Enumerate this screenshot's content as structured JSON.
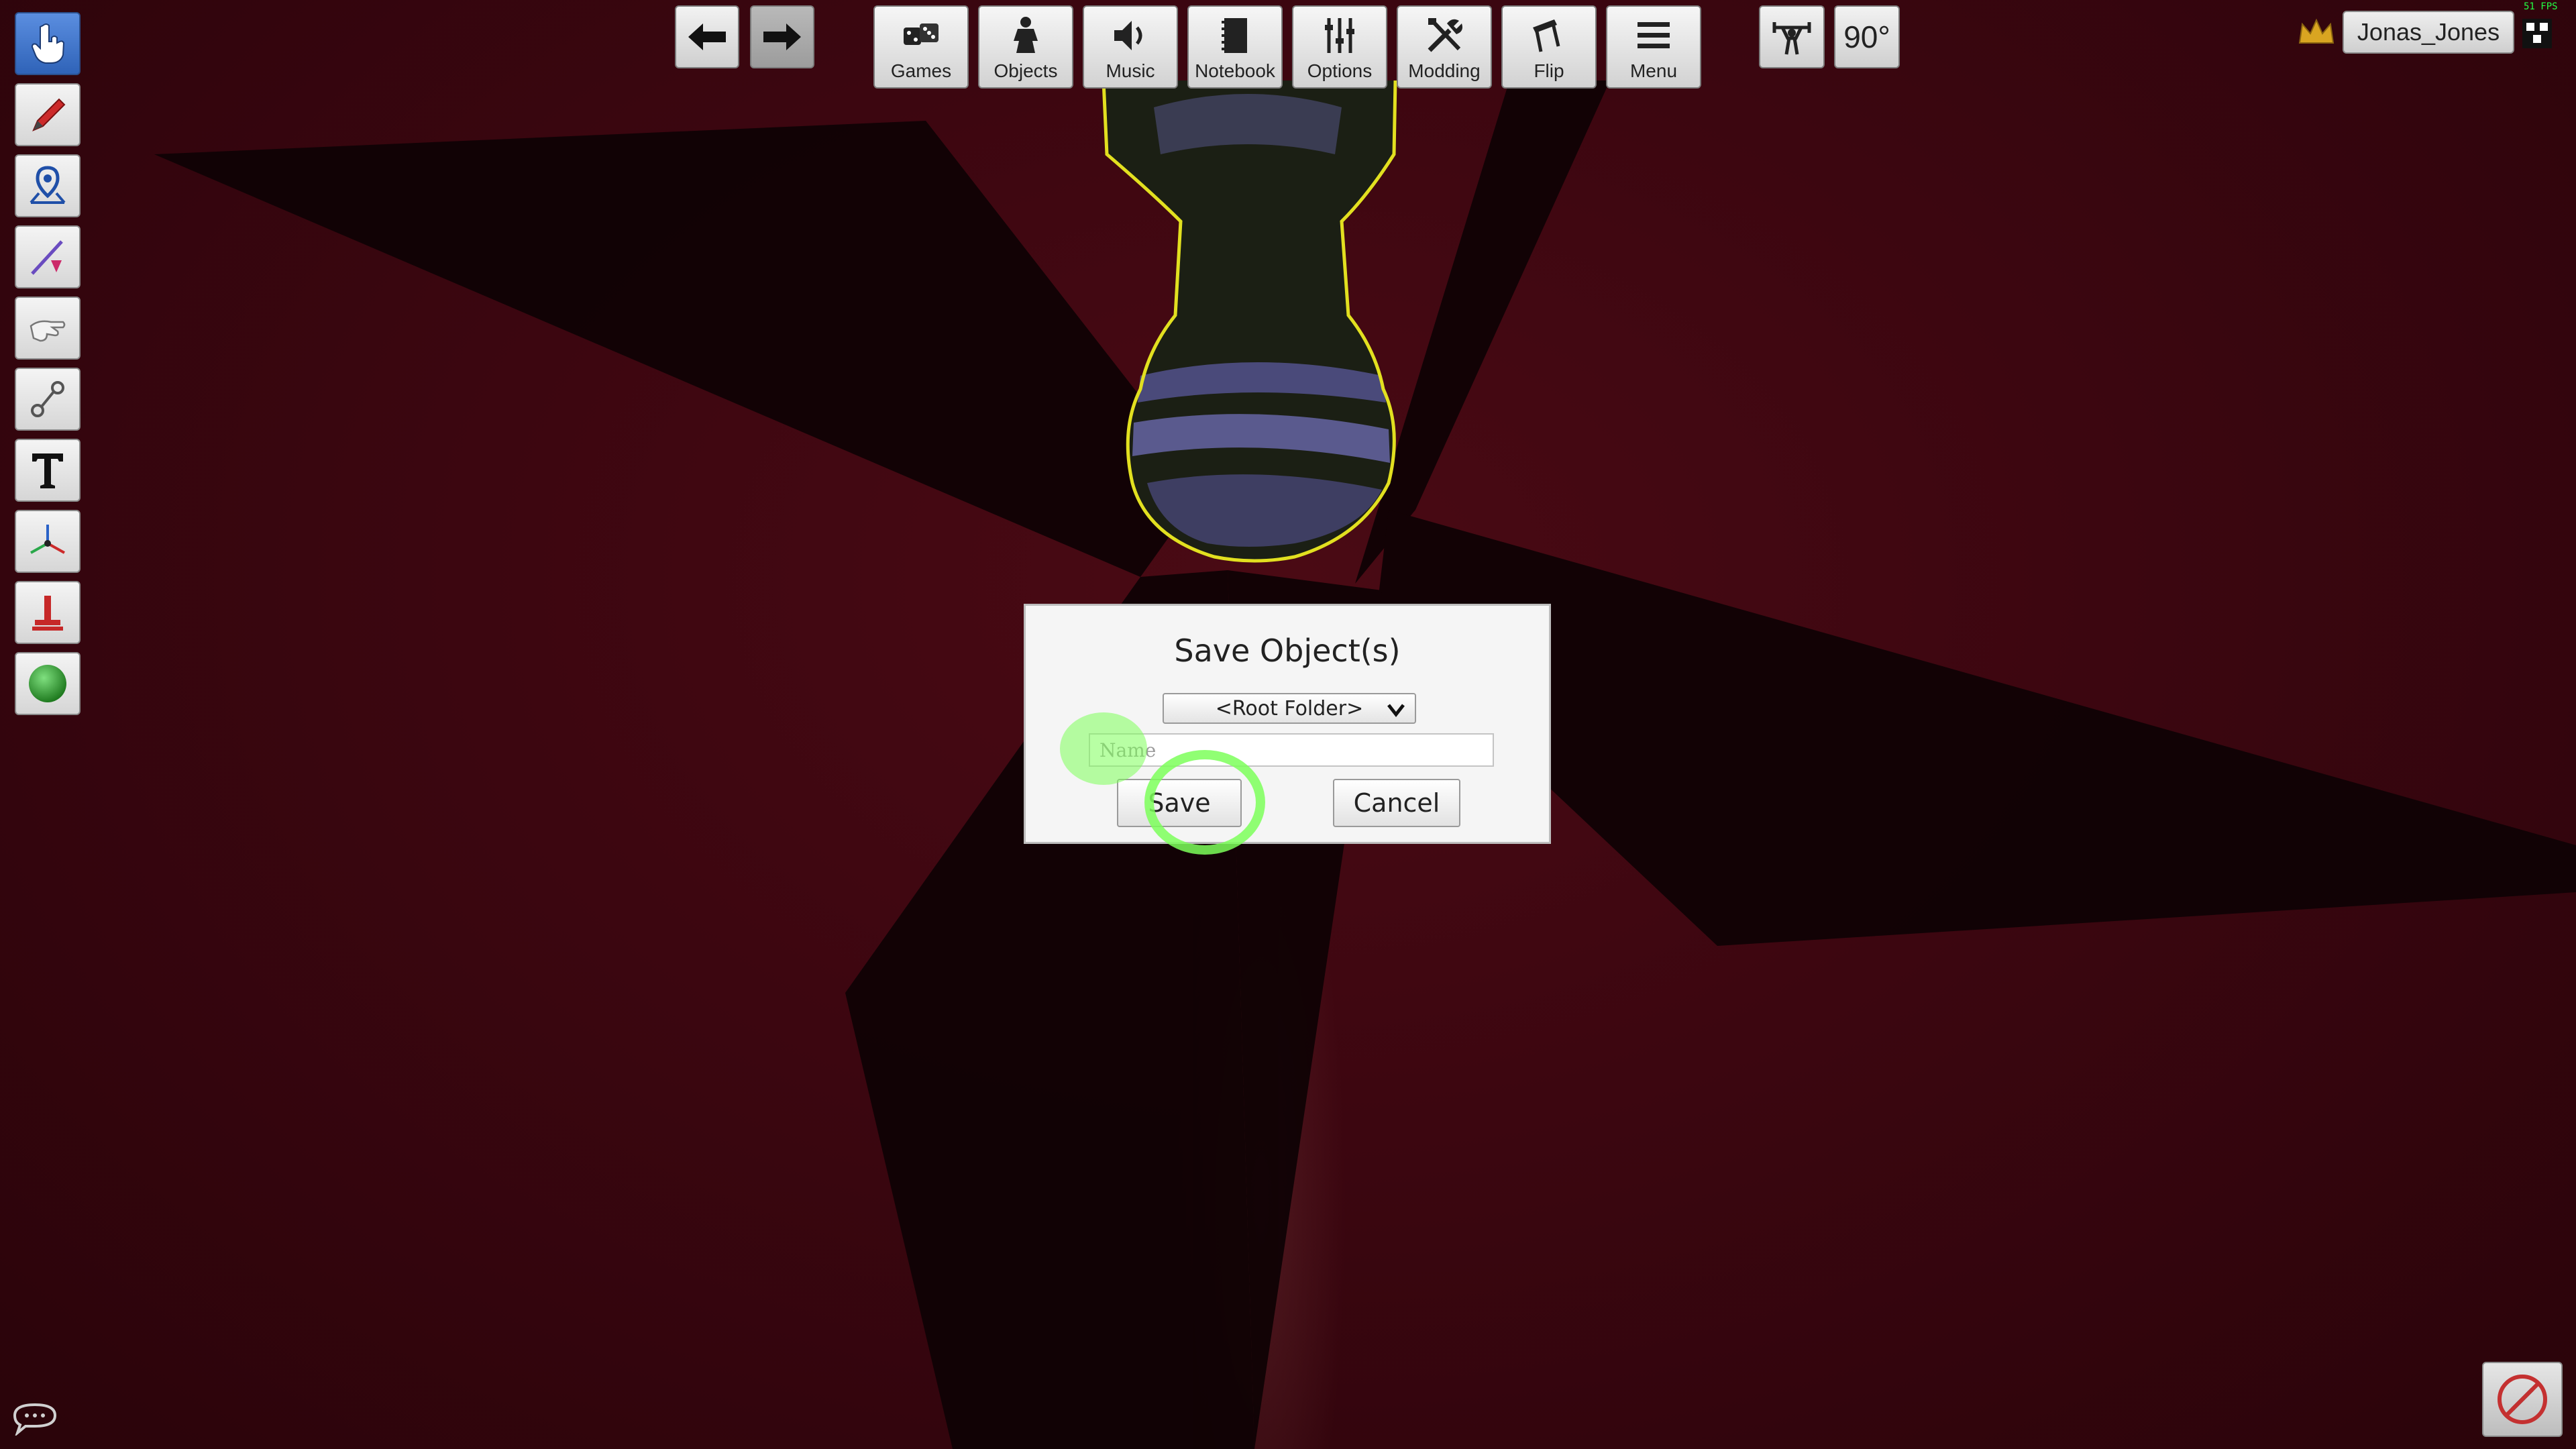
{
  "toolbar": {
    "items": [
      {
        "label": "Games",
        "icon": "dice-icon"
      },
      {
        "label": "Objects",
        "icon": "pawn-icon"
      },
      {
        "label": "Music",
        "icon": "speaker-icon"
      },
      {
        "label": "Notebook",
        "icon": "notebook-icon"
      },
      {
        "label": "Options",
        "icon": "sliders-icon"
      },
      {
        "label": "Modding",
        "icon": "tools-icon"
      },
      {
        "label": "Flip",
        "icon": "flip-table-icon"
      },
      {
        "label": "Menu",
        "icon": "hamburger-icon"
      }
    ],
    "rotation": "90°"
  },
  "user": {
    "name": "Jonas_Jones"
  },
  "fps": "51 FPS",
  "dialog": {
    "title": "Save Object(s)",
    "folder_selected": "<Root Folder>",
    "name_placeholder": "Name",
    "name_value": "",
    "save_label": "Save",
    "cancel_label": "Cancel"
  },
  "colors": {
    "table": "#3c0610",
    "highlight_ring": "#7dff5a",
    "selection_outline": "#e2e020",
    "active_tool": "#2f63b8"
  }
}
